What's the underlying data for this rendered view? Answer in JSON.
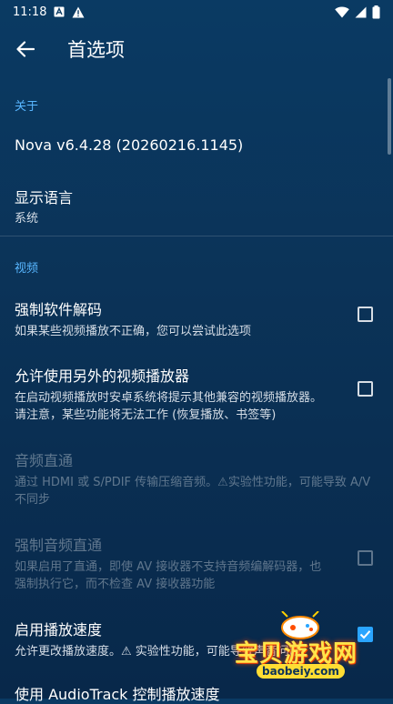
{
  "status": {
    "time": "11:18"
  },
  "app_bar": {
    "title": "首选项"
  },
  "sections": {
    "about_header": "关于",
    "video_header": "视频"
  },
  "about": {
    "version": "Nova v6.4.28 (20260216.1145)",
    "language_title": "显示语言",
    "language_value": "系统"
  },
  "video": {
    "force_sw": {
      "title": "强制软件解码",
      "sub": "如果某些视频播放不正确，您可以尝试此选项",
      "checked": false
    },
    "alt_player": {
      "title": "允许使用另外的视频播放器",
      "sub": "在启动视频播放时安卓系统将提示其他兼容的视频播放器。 请注意，某些功能将无法工作 (恢复播放、书签等)",
      "checked": false
    },
    "passthrough": {
      "title": "音频直通",
      "sub": "通过 HDMI 或 S/PDIF 传输压缩音频。⚠实验性功能，可能导致 A/V不同步"
    },
    "force_passthrough": {
      "title": "强制音频直通",
      "sub": "如果启用了直通，即使 AV 接收器不支持音频编解码器，也强制执行它，而不检查 AV 接收器功能",
      "checked": false
    },
    "speed": {
      "title": "启用播放速度",
      "sub": "允许更改播放速度。⚠ 实验性功能，可能导致声音问题",
      "checked": true
    },
    "audiotrack": {
      "title": "使用 AudioTrack 控制播放速度"
    }
  },
  "watermark": {
    "text": "宝贝游戏网",
    "url": "baobeiy.com"
  },
  "colors": {
    "accent": "#58b6ff",
    "checkbox_checked": "#2aa5ff",
    "background": "#0b3358"
  }
}
